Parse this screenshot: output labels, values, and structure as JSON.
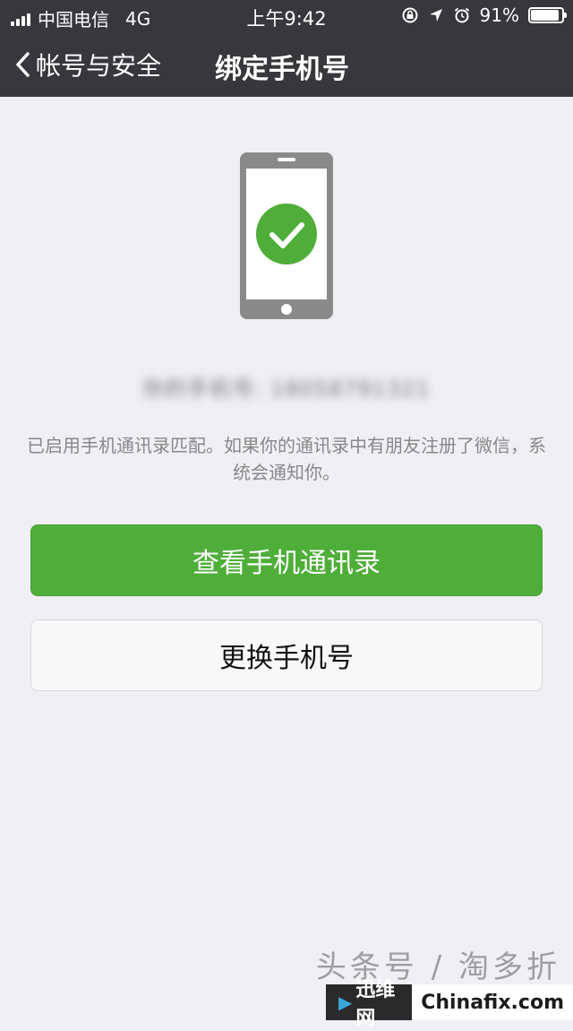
{
  "status_bar": {
    "carrier": "中国电信",
    "network": "4G",
    "time": "上午9:42",
    "battery_percent": "91%",
    "battery_level": 0.91,
    "icons": [
      "signal-icon",
      "rotation-lock-icon",
      "location-arrow-icon",
      "alarm-icon",
      "battery-icon"
    ]
  },
  "nav": {
    "back_label": "帐号与安全",
    "title": "绑定手机号"
  },
  "main": {
    "phone_number": "你的手机号: 18058791321",
    "hint": "已启用手机通讯录匹配。如果你的通讯录中有朋友注册了微信，系统会通知你。",
    "primary_button": "查看手机通讯录",
    "secondary_button": "更换手机号"
  },
  "watermark": {
    "text": "头条号 / 淘多折",
    "badge_left": "迅维网",
    "badge_right": "Chinafix.com"
  },
  "colors": {
    "nav_background": "#37373c",
    "page_background": "#efeff4",
    "accent_green": "#4fae39",
    "phone_gray": "#8a8a8a"
  }
}
